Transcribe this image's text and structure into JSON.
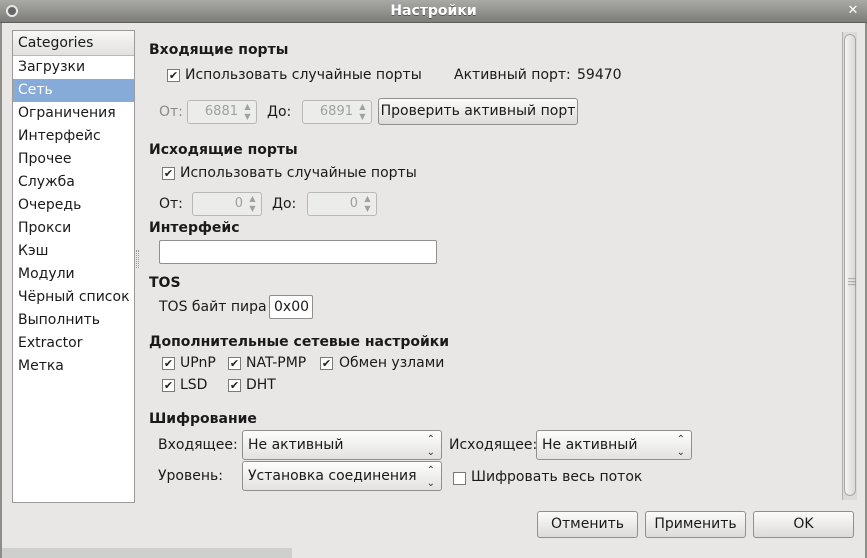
{
  "window": {
    "title": "Настройки"
  },
  "categories": {
    "header": "Categories",
    "items": [
      {
        "label": "Загрузки",
        "selected": false
      },
      {
        "label": "Сеть",
        "selected": true
      },
      {
        "label": "Ограничения",
        "selected": false
      },
      {
        "label": "Интерфейс",
        "selected": false
      },
      {
        "label": "Прочее",
        "selected": false
      },
      {
        "label": "Служба",
        "selected": false
      },
      {
        "label": "Очередь",
        "selected": false
      },
      {
        "label": "Прокси",
        "selected": false
      },
      {
        "label": "Кэш",
        "selected": false
      },
      {
        "label": "Модули",
        "selected": false
      },
      {
        "label": "Чёрный список",
        "selected": false
      },
      {
        "label": "Выполнить",
        "selected": false
      },
      {
        "label": "Extractor",
        "selected": false
      },
      {
        "label": "Метка",
        "selected": false
      }
    ]
  },
  "incoming": {
    "title": "Входящие порты",
    "random_ports_label": "Использовать случайные порты",
    "random_ports_checked": true,
    "active_port_label": "Активный порт:",
    "active_port_value": "59470",
    "from_label": "От:",
    "from_value": "6881",
    "to_label": "До:",
    "to_value": "6891",
    "check_button": "Проверить активный порт"
  },
  "outgoing": {
    "title": "Исходящие порты",
    "random_ports_label": "Использовать случайные порты",
    "random_ports_checked": true,
    "from_label": "От:",
    "from_value": "0",
    "to_label": "До:",
    "to_value": "0"
  },
  "interface": {
    "title": "Интерфейс",
    "value": ""
  },
  "tos": {
    "title": "TOS",
    "peer_byte_label": "TOS байт пира",
    "peer_byte_value": "0x00"
  },
  "advanced": {
    "title": "Дополнительные сетевые настройки",
    "upnp": {
      "label": "UPnP",
      "checked": true
    },
    "natpmp": {
      "label": "NAT-PMP",
      "checked": true
    },
    "pex": {
      "label": "Обмен узлами",
      "checked": true
    },
    "lsd": {
      "label": "LSD",
      "checked": true
    },
    "dht": {
      "label": "DHT",
      "checked": true
    }
  },
  "encryption": {
    "title": "Шифрование",
    "incoming_label": "Входящее:",
    "incoming_value": "Не активный",
    "outgoing_label": "Исходящее:",
    "outgoing_value": "Не активный",
    "level_label": "Уровень:",
    "level_value": "Установка соединения",
    "full_stream_label": "Шифровать весь поток",
    "full_stream_checked": false
  },
  "buttons": {
    "cancel": "Отменить",
    "apply": "Применить",
    "ok": "OK"
  }
}
